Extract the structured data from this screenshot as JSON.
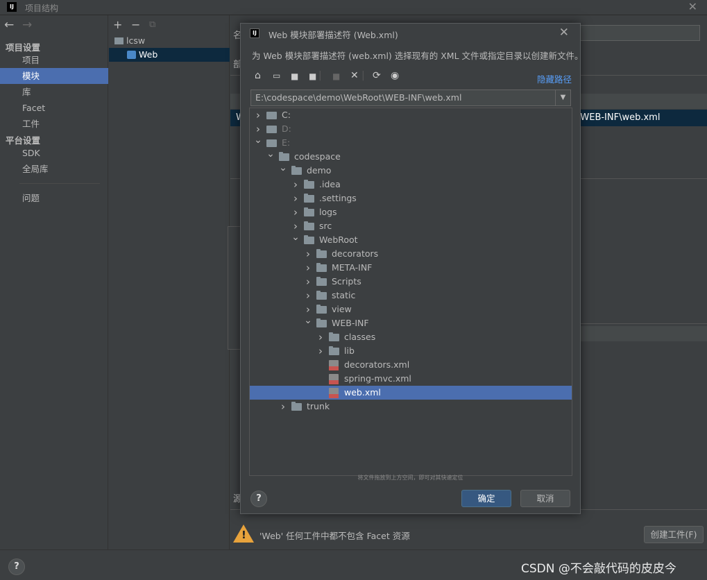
{
  "window": {
    "title": "项目结构",
    "close": "✕"
  },
  "nav": {
    "back": "←",
    "forward": "→"
  },
  "sidebar": {
    "project_settings": "项目设置",
    "items_a": [
      "项目",
      "模块",
      "库",
      "Facet",
      "工件"
    ],
    "platform_settings": "平台设置",
    "items_b": [
      "SDK",
      "全局库"
    ],
    "problems": "问题"
  },
  "modules": {
    "toolbar": {
      "add": "+",
      "remove": "−",
      "copy": "⧉"
    },
    "tree": [
      {
        "label": "lcsw"
      },
      {
        "label": "Web"
      }
    ]
  },
  "right": {
    "selected_row_text": "\\WEB-INF\\web.xml",
    "warning_text": "'Web' 任何工件中都不包含 Facet 资源",
    "create_artifact_button": "创建工件(F)",
    "fragments": [
      "名",
      "部",
      "W",
      "W",
      "部",
      "源"
    ]
  },
  "dialog": {
    "title": "Web 模块部署描述符 (Web.xml)",
    "description": "为 Web 模块部署描述符 (web.xml) 选择现有的 XML 文件或指定目录以创建新文件。",
    "hide_path": "隐藏路径",
    "path_value": "E:\\codespace\\demo\\WebRoot\\WEB-INF\\web.xml",
    "hint": "将文件拖放到上方空间，即可对其快速定位",
    "ok": "确定",
    "cancel": "取消",
    "help": "?",
    "tree": [
      {
        "label": "C:",
        "depth": 0,
        "type": "drive",
        "state": "collapsed"
      },
      {
        "label": "D:",
        "depth": 0,
        "type": "drive",
        "state": "collapsed",
        "dim": true
      },
      {
        "label": "E:",
        "depth": 0,
        "type": "drive",
        "state": "expanded",
        "dim": true
      },
      {
        "label": "codespace",
        "depth": 1,
        "type": "folder",
        "state": "expanded"
      },
      {
        "label": "demo",
        "depth": 2,
        "type": "folder",
        "state": "expanded"
      },
      {
        "label": ".idea",
        "depth": 3,
        "type": "folder",
        "state": "collapsed"
      },
      {
        "label": ".settings",
        "depth": 3,
        "type": "folder",
        "state": "collapsed"
      },
      {
        "label": "logs",
        "depth": 3,
        "type": "folder",
        "state": "collapsed"
      },
      {
        "label": "src",
        "depth": 3,
        "type": "folder",
        "state": "collapsed"
      },
      {
        "label": "WebRoot",
        "depth": 3,
        "type": "folder",
        "state": "expanded"
      },
      {
        "label": "decorators",
        "depth": 4,
        "type": "folder",
        "state": "collapsed"
      },
      {
        "label": "META-INF",
        "depth": 4,
        "type": "folder",
        "state": "collapsed"
      },
      {
        "label": "Scripts",
        "depth": 4,
        "type": "folder",
        "state": "collapsed"
      },
      {
        "label": "static",
        "depth": 4,
        "type": "folder",
        "state": "collapsed"
      },
      {
        "label": "view",
        "depth": 4,
        "type": "folder",
        "state": "collapsed"
      },
      {
        "label": "WEB-INF",
        "depth": 4,
        "type": "folder",
        "state": "expanded"
      },
      {
        "label": "classes",
        "depth": 5,
        "type": "folder",
        "state": "collapsed"
      },
      {
        "label": "lib",
        "depth": 5,
        "type": "folder",
        "state": "collapsed"
      },
      {
        "label": "decorators.xml",
        "depth": 5,
        "type": "xml",
        "state": "leaf"
      },
      {
        "label": "spring-mvc.xml",
        "depth": 5,
        "type": "xml",
        "state": "leaf"
      },
      {
        "label": "web.xml",
        "depth": 5,
        "type": "xml",
        "state": "leaf",
        "selected": true
      },
      {
        "label": "trunk",
        "depth": 2,
        "type": "folder",
        "state": "collapsed"
      }
    ]
  },
  "bottom": {
    "help": "?",
    "watermark": "CSDN @不会敲代码的皮皮今"
  }
}
